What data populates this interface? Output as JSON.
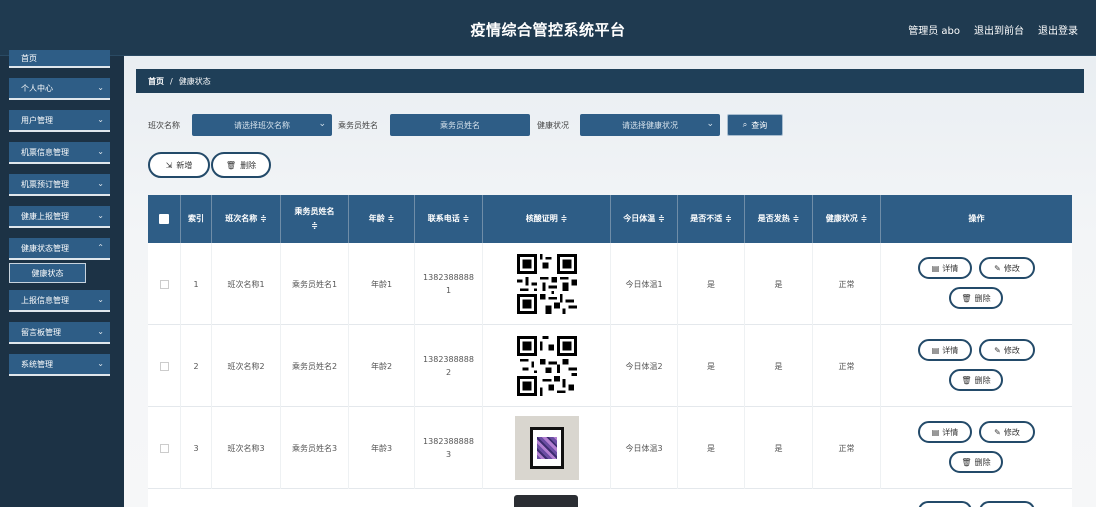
{
  "header": {
    "title": "疫情综合管控系统平台",
    "admin": "管理员 abo",
    "back_front": "退出到前台",
    "logout": "退出登录"
  },
  "sidebar": {
    "items": [
      {
        "label": "首页"
      },
      {
        "label": "个人中心"
      },
      {
        "label": "用户管理"
      },
      {
        "label": "机票信息管理"
      },
      {
        "label": "机票预订管理"
      },
      {
        "label": "健康上报管理"
      },
      {
        "label": "健康状态管理"
      },
      {
        "label": "上报信息管理"
      },
      {
        "label": "留言板管理"
      },
      {
        "label": "系统管理"
      }
    ],
    "sub_active": "健康状态"
  },
  "breadcrumb": {
    "home": "首页",
    "sep": "/",
    "current": "健康状态"
  },
  "search": {
    "class_label": "班次名称",
    "class_placeholder": "请选择班次名称",
    "name_label": "乘务员姓名",
    "name_placeholder": "乘务员姓名",
    "health_label": "健康状况",
    "health_placeholder": "请选择健康状况",
    "query_button": "查询"
  },
  "actions": {
    "add": "新增",
    "delete": "删除"
  },
  "table": {
    "headers": {
      "index": "索引",
      "class_name": "班次名称 ≑",
      "crew_name_1": "乘务员姓名",
      "crew_name_2": "≑",
      "age": "年龄 ≑",
      "phone": "联系电话 ≑",
      "proof": "核酸证明 ≑",
      "temp": "今日体温 ≑",
      "hot": "是否不适 ≑",
      "fever": "是否发热 ≑",
      "health": "健康状况 ≑",
      "ops": "操作"
    },
    "rows": [
      {
        "index": "1",
        "class_name": "班次名称1",
        "crew_name": "乘务员姓名1",
        "age": "年龄1",
        "phone_1": "1382388888",
        "phone_2": "1",
        "temp": "今日体温1",
        "hot": "是",
        "fever": "是",
        "health": "正常"
      },
      {
        "index": "2",
        "class_name": "班次名称2",
        "crew_name": "乘务员姓名2",
        "age": "年龄2",
        "phone_1": "1382388888",
        "phone_2": "2",
        "temp": "今日体温2",
        "hot": "是",
        "fever": "是",
        "health": "正常"
      },
      {
        "index": "3",
        "class_name": "班次名称3",
        "crew_name": "乘务员姓名3",
        "age": "年龄3",
        "phone_1": "1382388888",
        "phone_2": "3",
        "temp": "今日体温3",
        "hot": "是",
        "fever": "是",
        "health": "正常"
      }
    ],
    "op_detail": "详情",
    "op_edit": "修改",
    "op_delete": "删除"
  },
  "icons": {
    "chevron": "chevron-down-icon",
    "search": "search-icon",
    "add": "cursor-add-icon",
    "delete": "trash-icon",
    "detail": "doc-icon",
    "edit": "pencil-icon"
  }
}
